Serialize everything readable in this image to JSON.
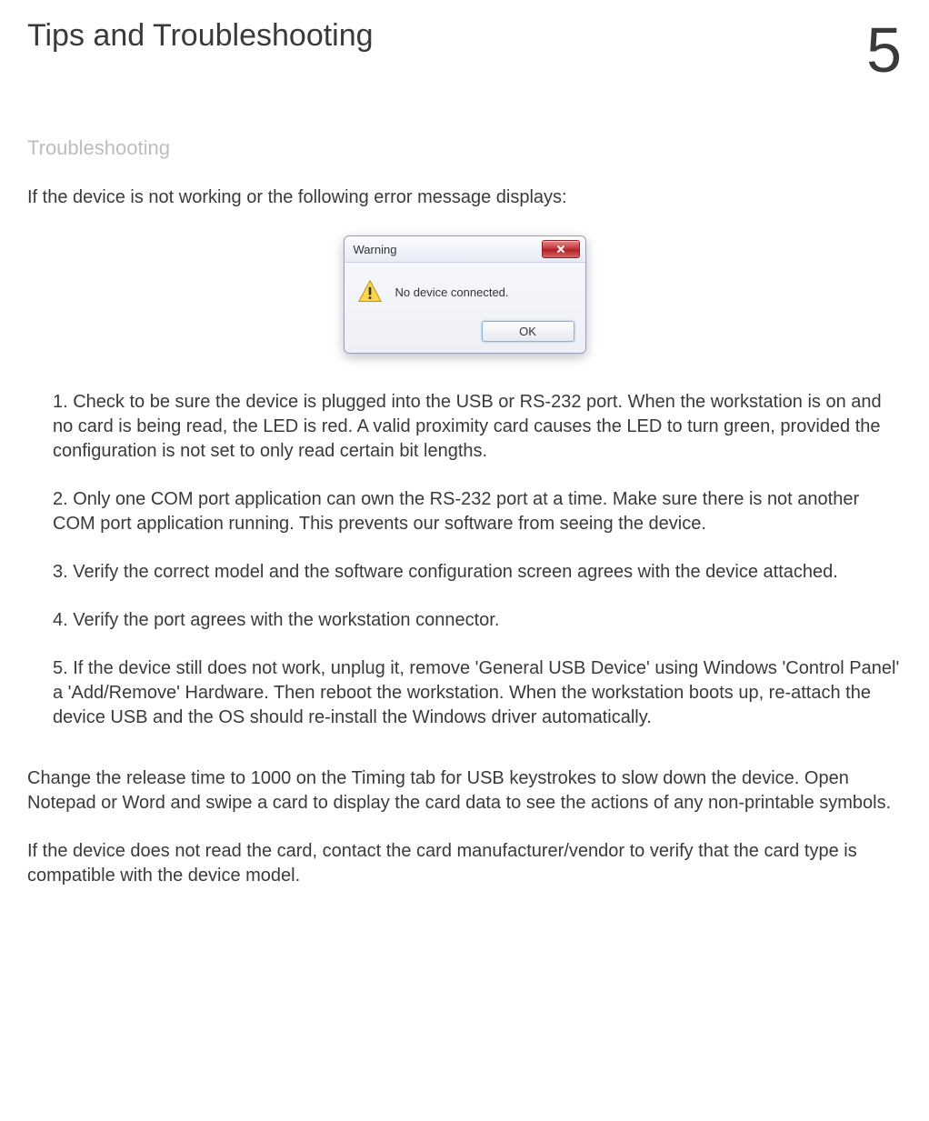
{
  "header": {
    "title": "Tips and Troubleshooting",
    "chapter": "5"
  },
  "subtitle": "Troubleshooting",
  "intro": "If the device is not working or the following  error  message displays:",
  "dialog": {
    "title": "Warning",
    "message": "No device connected.",
    "ok_label": "OK"
  },
  "steps": {
    "s1": "1.  Check  to be sure the device is plugged into the USB or RS-232 port. When the workstation is on and no card is being read, the LED is red. A valid proximity card causes the LED to turn green, provided the configuration is not set to only read certain bit lengths.",
    "s2": "2. Only one COM port application can own the RS-232 port at a time. Make sure there is not another COM port application running. This prevents our software from seeing the device.",
    "s3": "3. Verify the correct model and the software configuration screen agrees with the device attached.",
    "s4": "4.  Verify the port agrees with the workstation connector.",
    "s5": "5.  If the device still does not work, unplug it, remove  'General  USB Device'  using Windows 'Control Panel' a 'Add/Remove' Hardware. Then reboot the workstation. When the workstation  boots up, re-attach  the device  USB and the OS should  re-install  the Windows driver automatically."
  },
  "footer": {
    "p1": "Change the release time to 1000 on the Timing tab for USB keystrokes  to slow down the device. Open Notepad or Word and swipe a card to display the card data to see the actions of any non-printable symbols.",
    "p2": "If the device does not read the card, contact the card manufacturer/vendor to verify that the card type is compatible with the device model."
  }
}
